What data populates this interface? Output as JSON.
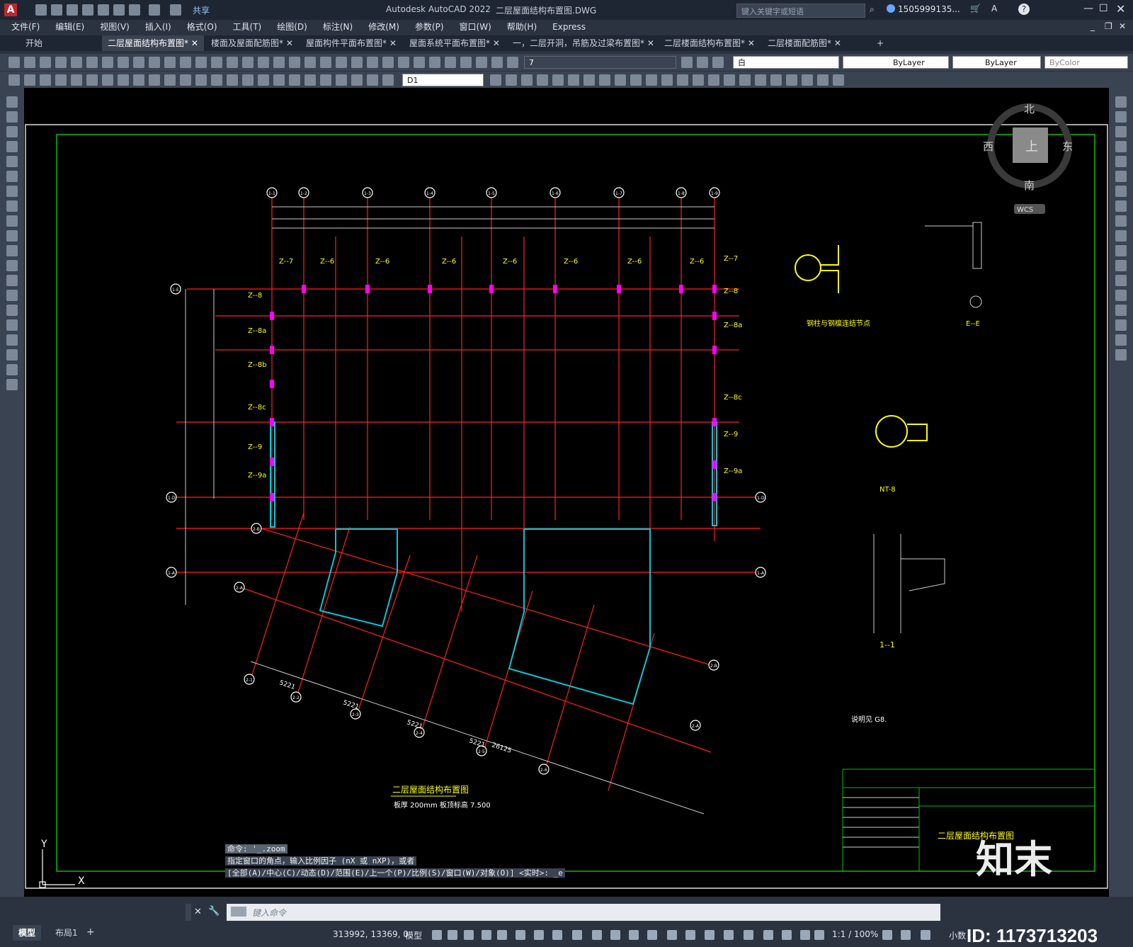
{
  "app": {
    "title": "Autodesk AutoCAD 2022",
    "filename": "二层屋面结构布置图.DWG",
    "search_placeholder": "键入关键字或短语",
    "user": "1505999135...",
    "share": "共享"
  },
  "menu": [
    "文件(F)",
    "编辑(E)",
    "视图(V)",
    "插入(I)",
    "格式(O)",
    "工具(T)",
    "绘图(D)",
    "标注(N)",
    "修改(M)",
    "参数(P)",
    "窗口(W)",
    "帮助(H)",
    "Express"
  ],
  "tabs": [
    "开始",
    "二层屋面结构布置图*",
    "楼面及屋面配筋图*",
    "屋面构件平面布置图*",
    "屋面系统平面布置图*",
    "一，二层开洞，吊筋及过梁布置图*",
    "二层楼面结构布置图*",
    "二层楼面配筋图*"
  ],
  "toolbar": {
    "layer_value": "7",
    "color_value": "白",
    "linetype_value": "ByLayer",
    "lineweight_value": "ByLayer",
    "plotstyle_value": "ByColor",
    "dimstyle_value": "D1"
  },
  "viewcube": {
    "north": "北",
    "south": "南",
    "east": "东",
    "west": "西",
    "top": "上",
    "wcs": "WCS"
  },
  "drawing": {
    "main_title": "二层屋面结构布置图",
    "subtitle": "板厚 200mm    板顶标高 7.500",
    "title_block_name": "二层屋面结构布置图",
    "note": "说明见 G8.",
    "detail_1": "钢柱与钢檩连结节点",
    "detail_2": "E--E",
    "detail_3": "NT-8",
    "detail_4": "1--1",
    "column_labels_top": [
      "Z--7",
      "Z--6",
      "Z--6",
      "Z--6",
      "Z--6",
      "Z--6",
      "Z--6",
      "Z--6"
    ],
    "column_labels_left": [
      "Z--8",
      "Z--8a",
      "Z--8b",
      "Z--8c",
      "Z--9",
      "Z--9a"
    ],
    "column_labels_right": [
      "Z--7",
      "Z--8",
      "Z--8a",
      "Z--8c",
      "Z--9",
      "Z--9a"
    ],
    "grid_top": [
      "1-1",
      "1-2",
      "1-3",
      "1-4",
      "1-5",
      "1-6",
      "1-7",
      "1-8",
      "1-9"
    ],
    "grid_left": [
      "1-E",
      "1-D",
      "2-B",
      "1-A",
      "2-A"
    ],
    "grid_right": [
      "1-D",
      "1-A",
      "2-B",
      "2-A"
    ],
    "grid_bottom": [
      "2-1",
      "2-2",
      "2-3",
      "2-4",
      "2-5",
      "2-6"
    ],
    "dims_bottom": [
      "5221",
      "5221",
      "5221",
      "5221",
      "26125"
    ]
  },
  "command": {
    "history_1": "命令: '_.zoom",
    "history_2": "指定窗口的角点，输入比例因子 (nX 或 nXP)，或者",
    "history_3": "[全部(A)/中心(C)/动态(D)/范围(E)/上一个(P)/比例(S)/窗口(W)/对象(O)] <实时>: _e",
    "placeholder": "键入命令"
  },
  "layout_tabs": [
    "模型",
    "布局1"
  ],
  "status": {
    "coords": "313992, 13369, 0",
    "space": "模型",
    "scale": "1:1 / 100%",
    "units": "小数"
  },
  "watermark": {
    "brand": "知末",
    "id": "ID: 1173713203"
  },
  "colors": {
    "canvas": "#000000",
    "grid_red": "#ff2020",
    "frame_green": "#00c000",
    "label_yellow": "#ffff00",
    "column_magenta": "#ff00ff",
    "beam_cyan": "#00c8d8"
  }
}
